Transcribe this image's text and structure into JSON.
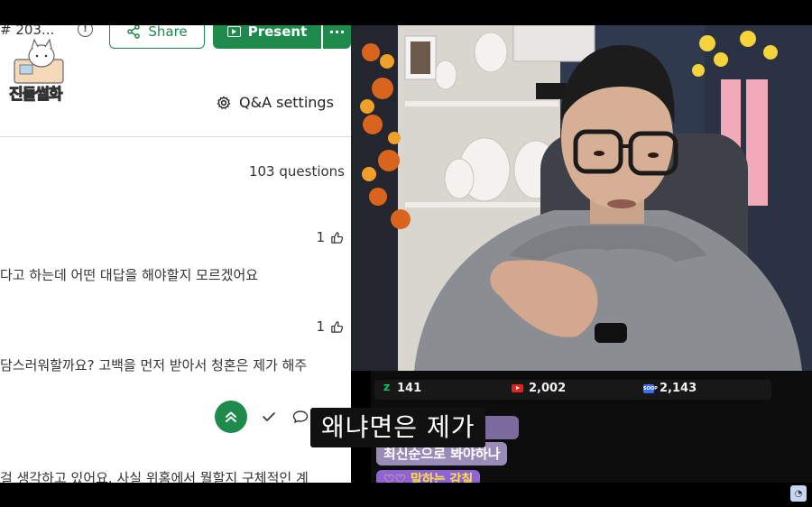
{
  "header": {
    "meta_title": "# 203...",
    "share_label": "Share",
    "present_label": "Present",
    "more_label": "···"
  },
  "logo": {
    "text": "진돌썰화"
  },
  "qa": {
    "settings_label": "Q&A settings",
    "question_count": "103 questions",
    "questions": [
      {
        "likes": "1",
        "text": "다고 하는데 어떤 대답을 해야할지 모르겠어요"
      },
      {
        "likes": "1",
        "text": "담스러워할까요? 고백을 먼저 받아서 청혼은 제가 해주"
      },
      {
        "likes": "",
        "text": "걸 생각하고 있어요. 사실 위홈에서 뭘할지 구체적인 계"
      }
    ]
  },
  "stats": {
    "chzzk": "141",
    "youtube": "2,002",
    "soop": "2,143"
  },
  "chat": {
    "lines": [
      "왜냐면은 제가",
      "최신순으로 봐야하나",
      "♡♡ 말하는 감칠"
    ]
  },
  "subtitle": "왜냐면은 제가",
  "colors": {
    "accent_green": "#1e8b4c",
    "youtube_red": "#e62117",
    "chzzk_green": "#00d26a",
    "soop_blue": "#3b6ff5"
  }
}
